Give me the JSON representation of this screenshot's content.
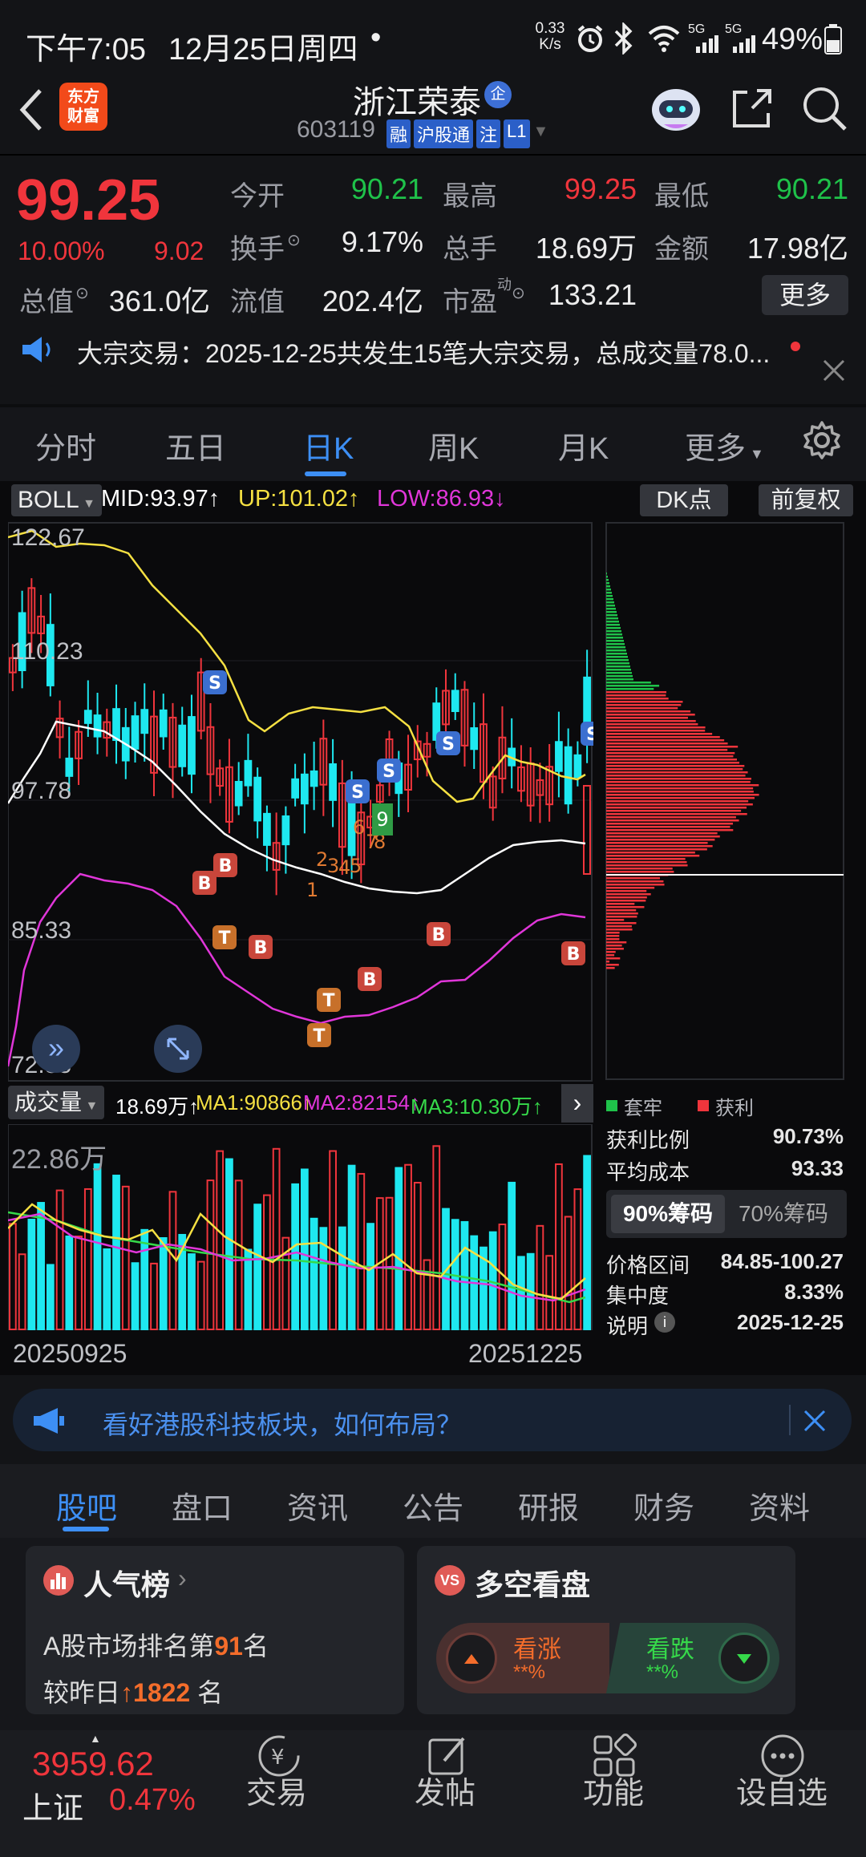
{
  "status_bar": {
    "time": "下午7:05",
    "date": "12月25日周四",
    "dot": "•",
    "net_speed_top": "0.33",
    "net_speed_unit": "K/s",
    "battery": "49%",
    "signal_5g_1": "5G",
    "signal_5g_2": "5G"
  },
  "header": {
    "logo_line1": "东方",
    "logo_line2": "财富",
    "stock_name": "浙江荣泰",
    "name_badge": "企",
    "code": "603119",
    "badges": [
      "融",
      "沪股通",
      "注",
      "L1"
    ]
  },
  "quote": {
    "price": "99.25",
    "change_pct": "10.00%",
    "change_abs": "9.02",
    "rows": [
      [
        {
          "label": "今开",
          "value": "90.21",
          "color": "green"
        },
        {
          "label": "最高",
          "value": "99.25",
          "color": "red"
        },
        {
          "label": "最低",
          "value": "90.21",
          "color": "green"
        }
      ],
      [
        {
          "label": "换手",
          "value": "9.17%",
          "color": "white"
        },
        {
          "label": "总手",
          "value": "18.69万",
          "color": "white"
        },
        {
          "label": "金额",
          "value": "17.98亿",
          "color": "white"
        }
      ],
      [
        {
          "label": "总值",
          "value": "361.0亿",
          "color": "white"
        },
        {
          "label": "流值",
          "value": "202.4亿",
          "color": "white"
        },
        {
          "label": "市盈",
          "label_sup": "动",
          "value": "133.21",
          "color": "white"
        }
      ]
    ],
    "more_button": "更多"
  },
  "news_ticker": "大宗交易：2025-12-25共发生15笔大宗交易，总成交量78.0...",
  "period_tabs": [
    "分时",
    "五日",
    "日K",
    "周K",
    "月K",
    "更多"
  ],
  "active_period": "日K",
  "indicator": {
    "name": "BOLL",
    "mid": "MID:93.97↑",
    "up": "UP:101.02↑",
    "low": "LOW:86.93↓",
    "dk_button": "DK点",
    "fq_button": "前复权"
  },
  "price_axis": [
    "122.67",
    "110.23",
    "97.78",
    "85.33",
    "72.88"
  ],
  "kline_markers": {
    "s": "S",
    "b": "B",
    "t": "T",
    "count_labels": [
      "1",
      "2",
      "3",
      "4",
      "5",
      "6",
      "7",
      "8",
      "9"
    ]
  },
  "volume": {
    "label": "成交量",
    "vol": "18.69万↑",
    "ma1": "MA1:90866↑",
    "ma2": "MA2:82154↑",
    "ma3": "MA3:10.30万↑",
    "axis_max": "22.86万"
  },
  "date_axis": {
    "start": "20250925",
    "end": "20251225"
  },
  "chip": {
    "legend_trapped": "套牢",
    "legend_profit": "获利",
    "rows": [
      {
        "label": "获利比例",
        "value": "90.73%"
      },
      {
        "label": "平均成本",
        "value": "93.33"
      }
    ],
    "tab_90": "90%筹码",
    "tab_70": "70%筹码",
    "rows2": [
      {
        "label": "价格区间",
        "value": "84.85-100.27"
      },
      {
        "label": "集中度",
        "value": "8.33%"
      },
      {
        "label": "说明",
        "value": "2025-12-25"
      }
    ]
  },
  "banner": "看好港股科技板块，如何布局？",
  "bottom_tabs": [
    "股吧",
    "盘口",
    "资讯",
    "公告",
    "研报",
    "财务",
    "资料"
  ],
  "active_bottom_tab": "股吧",
  "popularity": {
    "title": "人气榜",
    "rank_prefix": "A股市场排名第",
    "rank": "91",
    "rank_suffix": "名",
    "change_prefix": "较昨日",
    "change": "1822",
    "change_suffix": "名"
  },
  "bullbear": {
    "title": "多空看盘",
    "up_label": "看涨",
    "up_value": "**%",
    "down_label": "看跌",
    "down_value": "**%"
  },
  "footer": {
    "index_value": "3959.62",
    "index_name": "上证",
    "index_change": "0.47%",
    "nav": [
      "交易",
      "发帖",
      "功能",
      "设自选"
    ]
  },
  "colors": {
    "up": "#f0353c",
    "down": "#1fc24a",
    "accent": "#3d8ff5",
    "candle_down": "#1ee8f0",
    "boll_up": "#f5e042",
    "boll_low": "#e036d9",
    "boll_mid": "#ffffff"
  }
}
